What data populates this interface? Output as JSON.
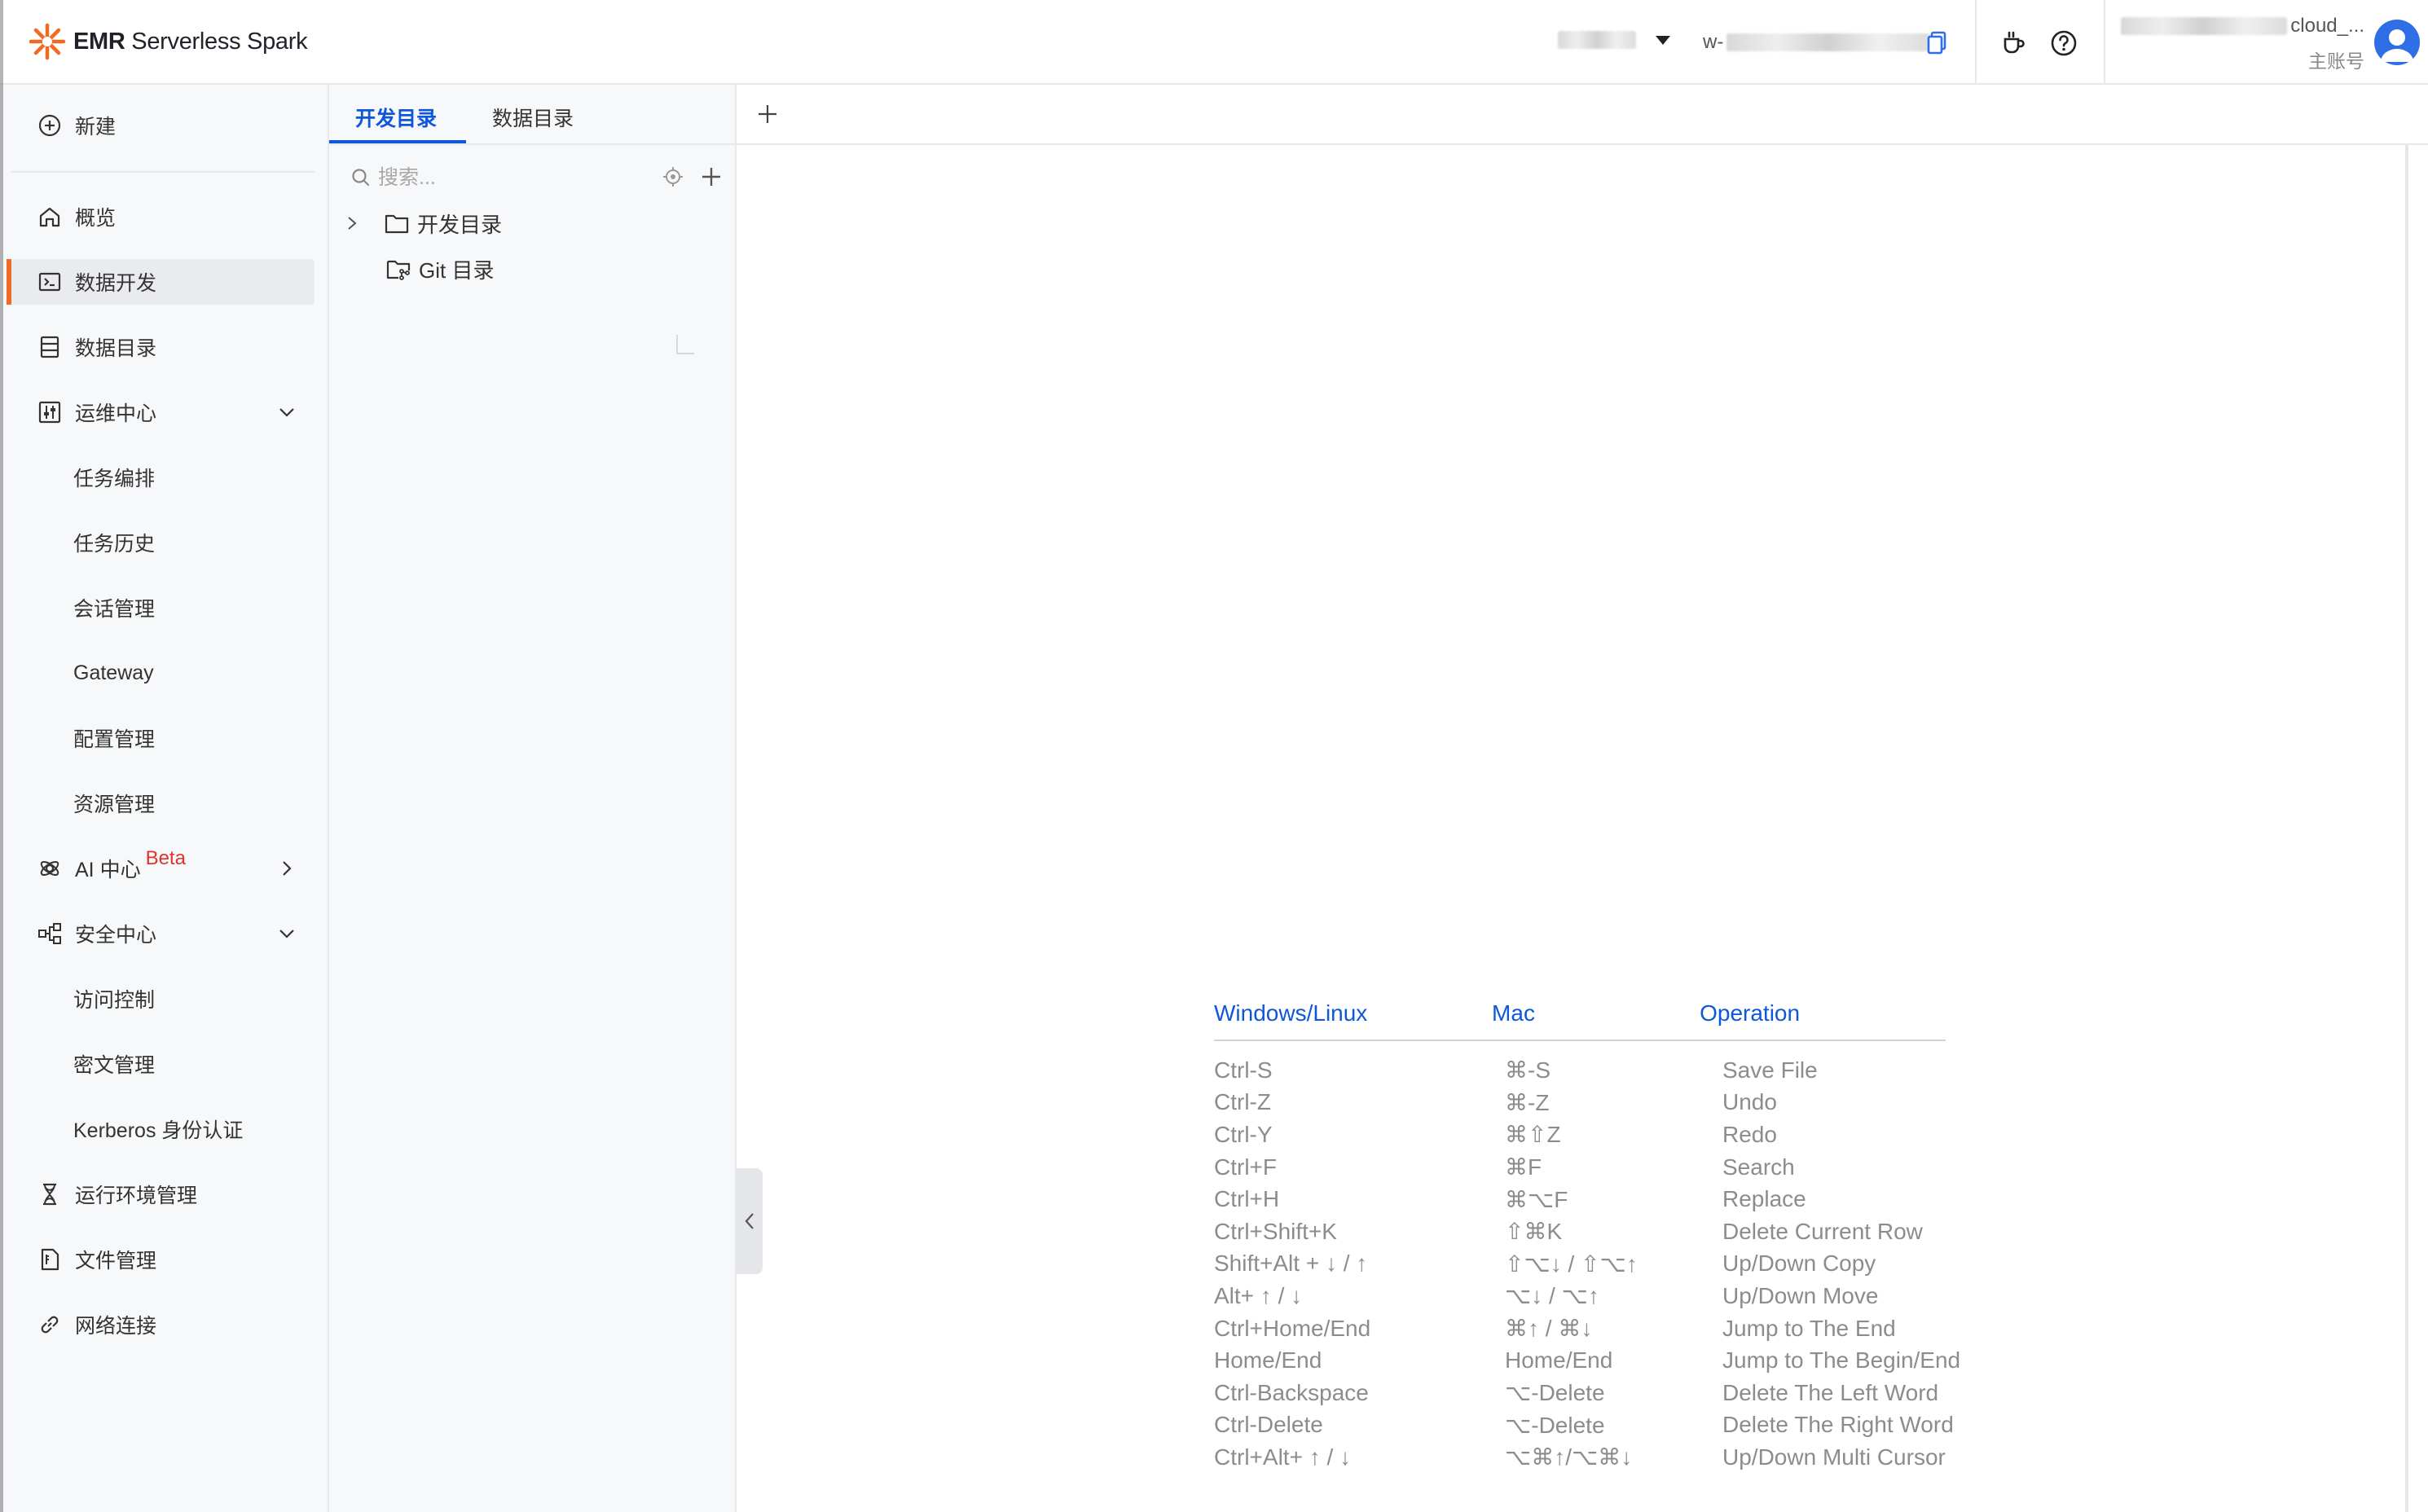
{
  "header": {
    "logo_bold": "EMR",
    "logo_rest": " Serverless Spark",
    "workspace_prefix": "w-",
    "account_name_suffix": "cloud_...",
    "account_sub": "主账号",
    "brand_color": "#f06a25",
    "accent_color": "#0e57d8"
  },
  "nav": {
    "new_label": "新建",
    "items": [
      {
        "label": "概览"
      },
      {
        "label": "数据开发"
      },
      {
        "label": "数据目录"
      },
      {
        "label": "运维中心"
      },
      {
        "label": "任务编排"
      },
      {
        "label": "任务历史"
      },
      {
        "label": "会话管理"
      },
      {
        "label": "Gateway"
      },
      {
        "label": "配置管理"
      },
      {
        "label": "资源管理"
      },
      {
        "label": "AI 中心",
        "badge": "Beta"
      },
      {
        "label": "安全中心"
      },
      {
        "label": "访问控制"
      },
      {
        "label": "密文管理"
      },
      {
        "label": "Kerberos 身份认证"
      },
      {
        "label": "运行环境管理"
      },
      {
        "label": "文件管理"
      },
      {
        "label": "网络连接"
      }
    ]
  },
  "explorer": {
    "tabs": [
      {
        "label": "开发目录"
      },
      {
        "label": "数据目录"
      }
    ],
    "search_placeholder": "搜索...",
    "tree": [
      {
        "label": "开发目录"
      },
      {
        "label": "Git 目录"
      }
    ]
  },
  "shortcuts": {
    "headers": [
      "Windows/Linux",
      "Mac",
      "Operation"
    ],
    "rows": [
      [
        "Ctrl-S",
        "⌘-S",
        "Save File"
      ],
      [
        "Ctrl-Z",
        "⌘-Z",
        "Undo"
      ],
      [
        "Ctrl-Y",
        "⌘⇧Z",
        "Redo"
      ],
      [
        "Ctrl+F",
        "⌘F",
        "Search"
      ],
      [
        "Ctrl+H",
        "⌘⌥F",
        "Replace"
      ],
      [
        "Ctrl+Shift+K",
        "⇧⌘K",
        "Delete Current Row"
      ],
      [
        "Shift+Alt + ↓ / ↑",
        "⇧⌥↓ / ⇧⌥↑",
        "Up/Down Copy"
      ],
      [
        "Alt+ ↑ / ↓",
        "⌥↓ / ⌥↑",
        "Up/Down Move"
      ],
      [
        "Ctrl+Home/End",
        "⌘↑ / ⌘↓",
        "Jump to The End"
      ],
      [
        "Home/End",
        "Home/End",
        "Jump to The Begin/End"
      ],
      [
        "Ctrl-Backspace",
        "⌥-Delete",
        "Delete The Left Word"
      ],
      [
        "Ctrl-Delete",
        "⌥-Delete",
        "Delete The Right Word"
      ],
      [
        "Ctrl+Alt+ ↑ / ↓",
        "⌥⌘↑/⌥⌘↓",
        "Up/Down Multi Cursor"
      ]
    ]
  }
}
